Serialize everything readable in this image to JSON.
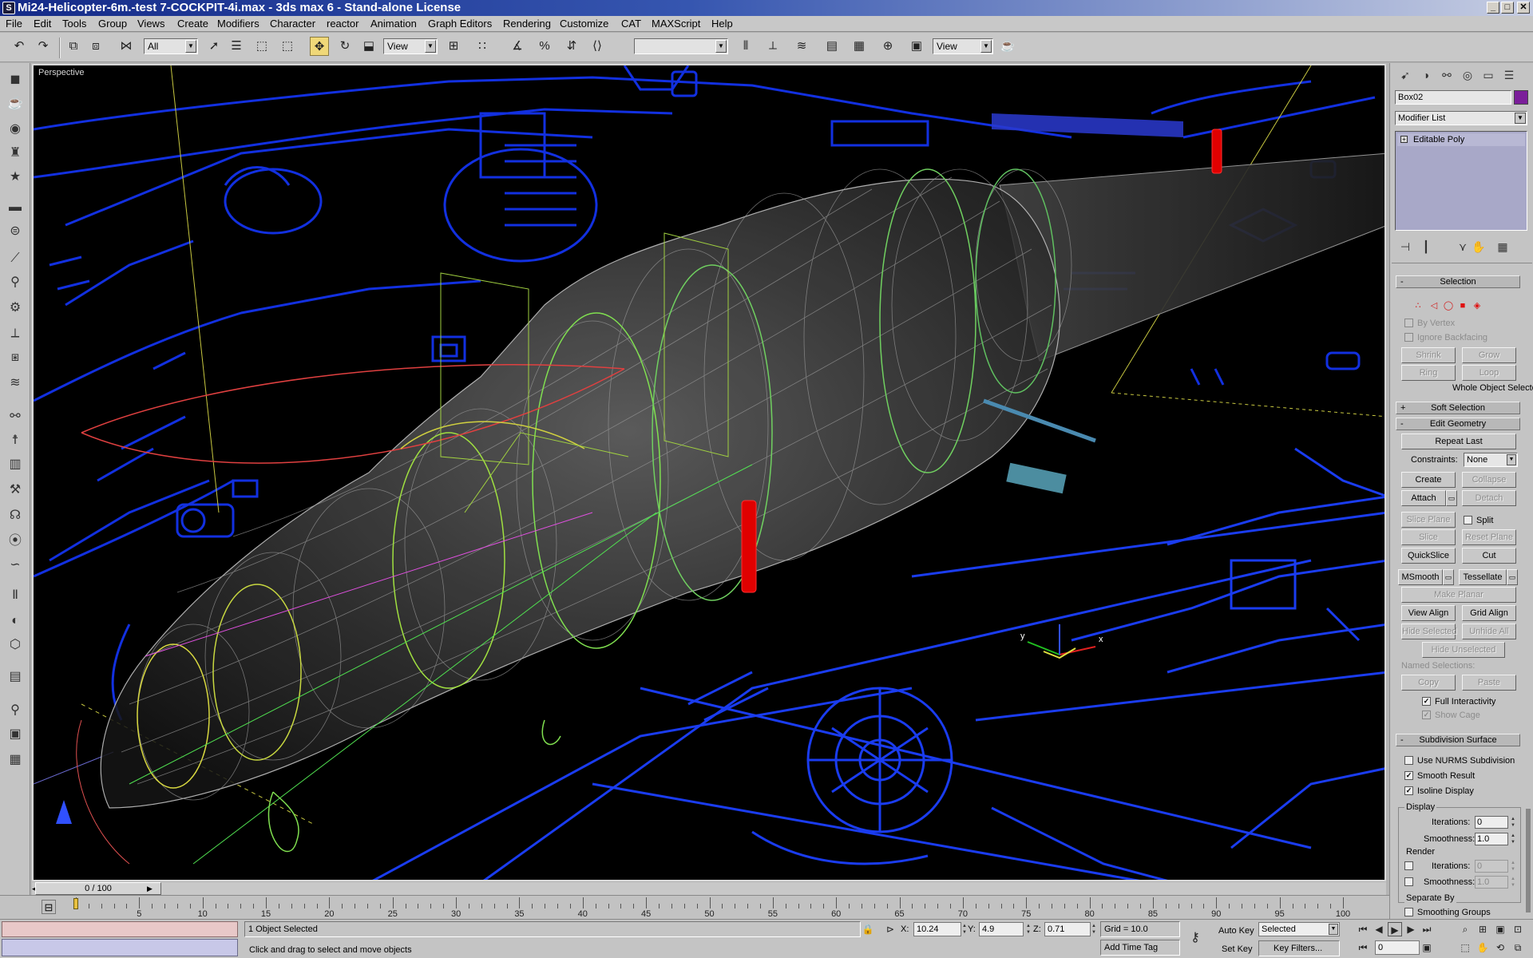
{
  "window": {
    "title": "Mi24-Helicopter-6m.-test 7-COCKPIT-4i.max - 3ds max 6 - Stand-alone License",
    "app_icon": "3ds-max-icon",
    "buttons": {
      "minimize": "_",
      "maximize": "□",
      "close": "✕"
    }
  },
  "menu": [
    "File",
    "Edit",
    "Tools",
    "Group",
    "Views",
    "Create",
    "Modifiers",
    "Character",
    "reactor",
    "Animation",
    "Graph Editors",
    "Rendering",
    "Customize",
    "CAT",
    "MAXScript",
    "Help"
  ],
  "toolbar": {
    "selection_filter": "All",
    "reference_coord": "View",
    "named_selection": "",
    "render_type": "View"
  },
  "viewport": {
    "label": "Perspective",
    "bg_color": "#000000",
    "blueprint_color": "#1230e0",
    "gizmo": {
      "x": "x",
      "y": "y"
    }
  },
  "command_panel": {
    "object_name": "Box02",
    "object_color": "#7b1e9a",
    "modifier_list": "Modifier List",
    "stack_item": "Editable Poly",
    "selection": {
      "title": "Selection",
      "by_vertex": "By Vertex",
      "ignore_backfacing": "Ignore Backfacing",
      "shrink": "Shrink",
      "grow": "Grow",
      "ring": "Ring",
      "loop": "Loop",
      "status": "Whole Object Selected"
    },
    "soft_selection": {
      "title": "Soft Selection"
    },
    "edit_geometry": {
      "title": "Edit Geometry",
      "repeat_last": "Repeat Last",
      "constraints_label": "Constraints:",
      "constraints_value": "None",
      "create": "Create",
      "collapse": "Collapse",
      "attach": "Attach",
      "detach": "Detach",
      "slice_plane": "Slice Plane",
      "split": "Split",
      "slice": "Slice",
      "reset_plane": "Reset Plane",
      "quickslice": "QuickSlice",
      "cut": "Cut",
      "msmooth": "MSmooth",
      "tessellate": "Tessellate",
      "make_planar": "Make Planar",
      "view_align": "View Align",
      "grid_align": "Grid Align",
      "hide_selected": "Hide Selected",
      "unhide_all": "Unhide All",
      "hide_unselected": "Hide Unselected",
      "named_selections": "Named Selections:",
      "copy": "Copy",
      "paste": "Paste",
      "full_interactivity": "Full Interactivity",
      "show_cage": "Show Cage"
    },
    "subdivision": {
      "title": "Subdivision Surface",
      "use_nurms": "Use NURMS Subdivision",
      "smooth_result": "Smooth Result",
      "isoline_display": "Isoline Display",
      "display": "Display",
      "iterations_label": "Iterations:",
      "display_iterations": "0",
      "smoothness_label": "Smoothness:",
      "display_smoothness": "1.0",
      "render": "Render",
      "render_iterations": "0",
      "render_smoothness": "1.0",
      "separate_by": "Separate By",
      "smoothing_groups": "Smoothing Groups"
    }
  },
  "timeline": {
    "position": "0 / 100",
    "current_frame": 0,
    "ticks": [
      "5",
      "10",
      "15",
      "20",
      "25",
      "30",
      "35",
      "40",
      "45",
      "50",
      "55",
      "60",
      "65",
      "70",
      "75",
      "80",
      "85",
      "90",
      "95",
      "100"
    ]
  },
  "status": {
    "objects_selected": "1 Object Selected",
    "prompt": "Click and drag to select and move objects",
    "x_label": "X:",
    "x": "10.24",
    "y_label": "Y:",
    "y": "4.9",
    "z_label": "Z:",
    "z": "0.71",
    "grid": "Grid = 10.0",
    "add_time_tag": "Add Time Tag",
    "auto_key": "Auto Key",
    "auto_key_value": "Selected",
    "set_key": "Set Key",
    "key_filters": "Key Filters...",
    "frame": "0"
  }
}
